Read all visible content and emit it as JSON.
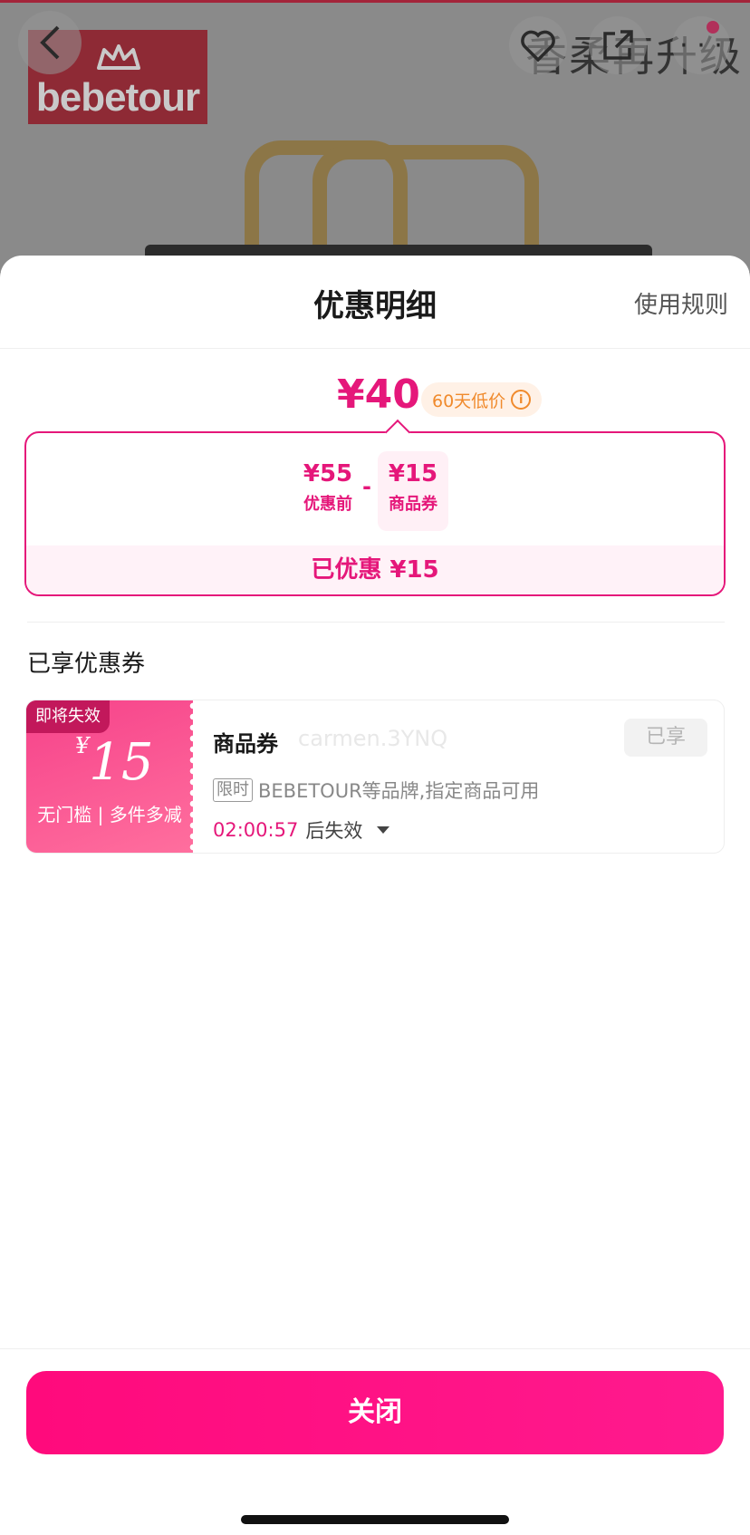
{
  "background": {
    "brand_logo_text": "bebetour",
    "page_title": "香柔再升级",
    "back_icon": "chevron-left-icon",
    "fav_icon": "heart-icon",
    "share_icon": "share-icon",
    "more_icon": "more-icon"
  },
  "sheet": {
    "title": "优惠明细",
    "rules_link": "使用规则"
  },
  "price": {
    "final_price": "¥40",
    "low_price_badge": "60天低价",
    "info_icon_glyph": "i",
    "before_amount": "¥55",
    "before_label": "优惠前",
    "minus_sign": "-",
    "coupon_amount": "¥15",
    "coupon_label": "商品券",
    "saved_text": "已优惠 ¥15"
  },
  "coupons_section": {
    "title": "已享优惠券",
    "coupon": {
      "expire_tag": "即将失效",
      "currency_symbol": "¥",
      "amount": "15",
      "condition": "无门槛 | 多件多减",
      "name": "商品券",
      "watermark": "carmen.3YNQ",
      "status": "已享",
      "limit_tag": "限时",
      "description": "BEBETOUR等品牌,指定商品可用",
      "timer": "02:00:57",
      "timer_suffix": "后失效"
    }
  },
  "footer": {
    "close_label": "关闭"
  },
  "colors": {
    "accent": "#e5177a",
    "button": "#ff0a7c",
    "badge_orange": "#f08a2c"
  }
}
